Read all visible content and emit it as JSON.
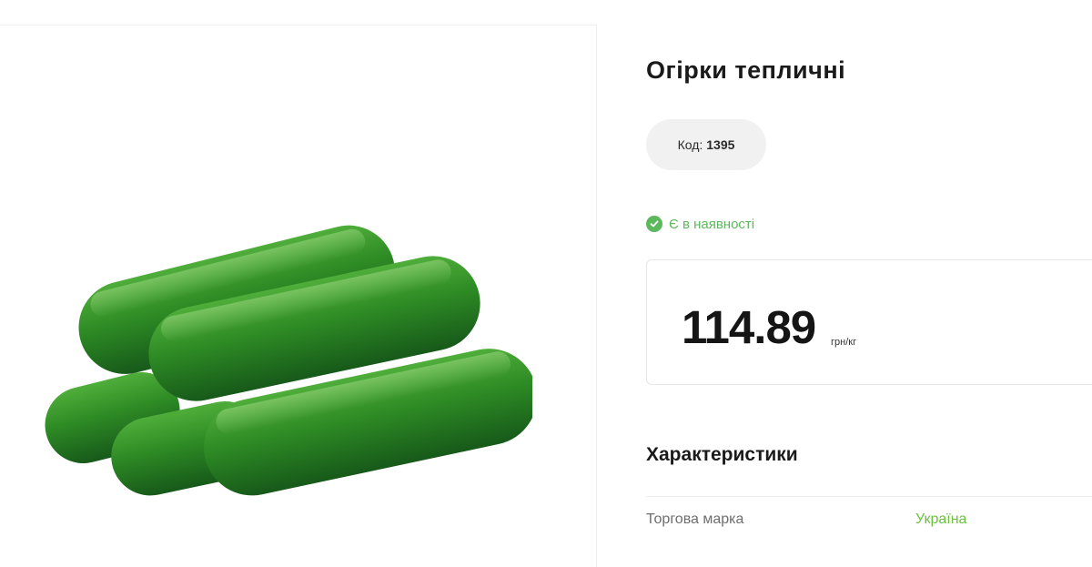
{
  "product": {
    "title": "Огірки тепличні",
    "code_label": "Код:",
    "code_value": "1395",
    "stock_text": "Є в наявності",
    "price": "114.89",
    "price_unit": "грн/кг",
    "image_alt": "cucumbers"
  },
  "specs": {
    "title": "Характеристики",
    "rows": [
      {
        "label": "Торгова марка",
        "value": "Україна"
      }
    ]
  },
  "colors": {
    "accent_green": "#5cb85c",
    "link_green": "#6cbf3f",
    "cucumber": "#2f8f2a"
  }
}
